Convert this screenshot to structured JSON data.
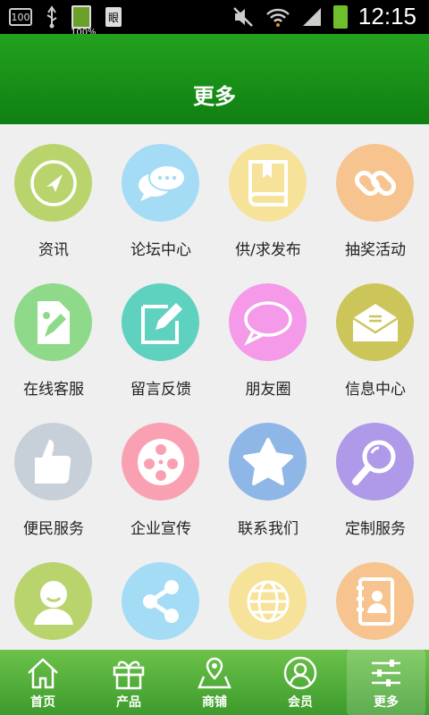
{
  "status_bar": {
    "box_text": "100",
    "battery_small_label": "100%",
    "time": "12:15"
  },
  "header": {
    "title": "更多"
  },
  "grid": [
    {
      "label": "资讯",
      "icon": "compass-icon",
      "color": "#b9d46d"
    },
    {
      "label": "论坛中心",
      "icon": "chat-bubbles-icon",
      "color": "#a5dcf5"
    },
    {
      "label": "供/求发布",
      "icon": "book-icon",
      "color": "#f7e29a"
    },
    {
      "label": "抽奖活动",
      "icon": "chain-link-icon",
      "color": "#f7c48f"
    },
    {
      "label": "在线客服",
      "icon": "document-pen-icon",
      "color": "#8fd98a"
    },
    {
      "label": "留言反馈",
      "icon": "edit-icon",
      "color": "#5fd1bf"
    },
    {
      "label": "朋友圈",
      "icon": "speech-bubble-icon",
      "color": "#f49ae8"
    },
    {
      "label": "信息中心",
      "icon": "envelope-icon",
      "color": "#ccc65a"
    },
    {
      "label": "便民服务",
      "icon": "thumbs-up-icon",
      "color": "#c7d0d9"
    },
    {
      "label": "企业宣传",
      "icon": "film-reel-icon",
      "color": "#f9a1b2"
    },
    {
      "label": "联系我们",
      "icon": "star-icon",
      "color": "#8eb6e6"
    },
    {
      "label": "定制服务",
      "icon": "magnifier-icon",
      "color": "#ae9ae8"
    },
    {
      "label": "",
      "icon": "user-icon",
      "color": "#b9d46d"
    },
    {
      "label": "",
      "icon": "share-icon",
      "color": "#a5dcf5"
    },
    {
      "label": "",
      "icon": "globe-icon",
      "color": "#f7e29a"
    },
    {
      "label": "",
      "icon": "contact-book-icon",
      "color": "#f7c48f"
    }
  ],
  "tabs": [
    {
      "label": "首页",
      "icon": "home-icon",
      "active": false
    },
    {
      "label": "产品",
      "icon": "gift-icon",
      "active": false
    },
    {
      "label": "商铺",
      "icon": "map-icon",
      "active": false
    },
    {
      "label": "会员",
      "icon": "member-icon",
      "active": false
    },
    {
      "label": "更多",
      "icon": "settings-sliders-icon",
      "active": true
    }
  ]
}
